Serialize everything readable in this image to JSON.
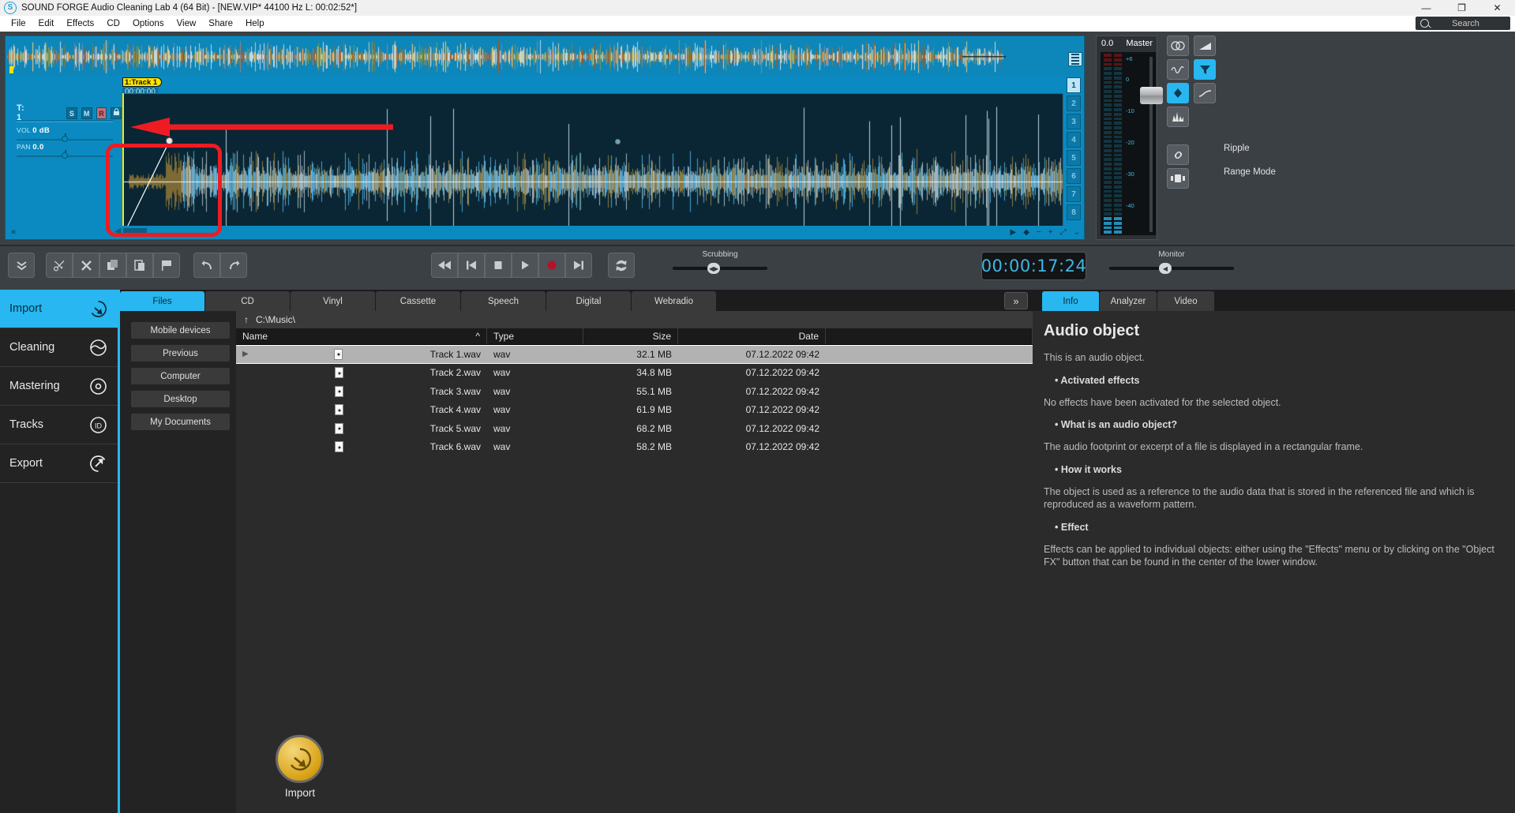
{
  "window": {
    "app_icon": "sound-forge-logo",
    "title": "SOUND FORGE Audio Cleaning Lab 4 (64 Bit) - [NEW.VIP*   44100 Hz L: 00:02:52*]",
    "minimize": "—",
    "restore": "❐",
    "close": "✕"
  },
  "menubar": {
    "items": [
      "File",
      "Edit",
      "Effects",
      "CD",
      "Options",
      "View",
      "Share",
      "Help"
    ]
  },
  "search": {
    "placeholder": "Search",
    "icon": "search-icon"
  },
  "arranger": {
    "track_tab": "1:Track 1",
    "ruler_time": "00:00:00",
    "track_label": "T:  1",
    "buttons": [
      "S",
      "M",
      "R",
      "🔒"
    ],
    "vol_label": "VOL",
    "vol_value": "0 dB",
    "pan_label": "PAN",
    "pan_value": "0.0",
    "track_numbers": [
      "1",
      "2",
      "3",
      "4",
      "5",
      "6",
      "7",
      "8"
    ],
    "active_track": "1",
    "fx_icon": "gear-icon",
    "collapse_icon": "«"
  },
  "master": {
    "value": "0.0",
    "label": "Master",
    "scale": [
      "+6",
      "0",
      "-10",
      "-20",
      "-30",
      "-40"
    ]
  },
  "tools": {
    "col1": [
      "stereo-icon",
      "waveform-icon",
      "object-icon",
      "peaks-icon"
    ],
    "col2": [
      "fade-in-icon",
      "fade-funnel-icon",
      "fade-curve-icon"
    ],
    "ripple_label": "Ripple",
    "ripple_icon": "link-icon",
    "range_label": "Range Mode",
    "range_icon": "range-icon"
  },
  "toolbar": {
    "left_group": [
      "chevron-double-down-icon"
    ],
    "edit_group": [
      "scissors-cut-icon",
      "delete-x-icon",
      "copy-icon",
      "paste-icon",
      "marker-flag-icon"
    ],
    "history_group": [
      "undo-icon",
      "redo-icon"
    ]
  },
  "transport": {
    "buttons": [
      "skip-start-icon",
      "prev-marker-icon",
      "stop-icon",
      "play-icon",
      "record-icon",
      "skip-end-icon"
    ],
    "loop_icon": "loop-icon",
    "scrubbing_label": "Scrubbing",
    "timecode": "00:00:17:24",
    "monitor_label": "Monitor"
  },
  "sidebar": {
    "items": [
      {
        "label": "Import",
        "icon": "import-arrow-icon",
        "active": true
      },
      {
        "label": "Cleaning",
        "icon": "cleaning-icon",
        "active": false
      },
      {
        "label": "Mastering",
        "icon": "mastering-disc-icon",
        "active": false
      },
      {
        "label": "Tracks",
        "icon": "tracks-id-icon",
        "active": false
      },
      {
        "label": "Export",
        "icon": "export-arrow-icon",
        "active": false
      }
    ]
  },
  "source_tabs": {
    "items": [
      "Files",
      "CD",
      "Vinyl",
      "Cassette",
      "Speech",
      "Digital",
      "Webradio"
    ],
    "active": "Files",
    "expand_icon": "chevron-double-right-icon"
  },
  "places": {
    "buttons": [
      "Mobile devices",
      "Previous",
      "Computer",
      "Desktop",
      "My Documents"
    ]
  },
  "import_button": {
    "label": "Import",
    "icon": "import-circle-icon"
  },
  "filebrowser": {
    "path": "C:\\Music\\",
    "up_icon": "arrow-up-icon",
    "columns": [
      "Name",
      "Type",
      "Size",
      "Date"
    ],
    "sort_indicator": "^",
    "rows": [
      {
        "name": "Track 1.wav",
        "type": "wav",
        "size": "32.1 MB",
        "date": "07.12.2022 09:42",
        "selected": true
      },
      {
        "name": "Track 2.wav",
        "type": "wav",
        "size": "34.8 MB",
        "date": "07.12.2022 09:42",
        "selected": false
      },
      {
        "name": "Track 3.wav",
        "type": "wav",
        "size": "55.1 MB",
        "date": "07.12.2022 09:42",
        "selected": false
      },
      {
        "name": "Track 4.wav",
        "type": "wav",
        "size": "61.9 MB",
        "date": "07.12.2022 09:42",
        "selected": false
      },
      {
        "name": "Track 5.wav",
        "type": "wav",
        "size": "68.2 MB",
        "date": "07.12.2022 09:42",
        "selected": false
      },
      {
        "name": "Track 6.wav",
        "type": "wav",
        "size": "58.2 MB",
        "date": "07.12.2022 09:42",
        "selected": false
      }
    ]
  },
  "info_panel": {
    "tabs": [
      "Info",
      "Analyzer",
      "Video"
    ],
    "active_tab": "Info",
    "heading": "Audio object",
    "intro": "This is an audio object.",
    "sections": [
      {
        "bullet": "Activated effects",
        "text": "No effects have been activated for the selected object."
      },
      {
        "bullet": "What is an audio object?",
        "text": "The audio footprint or excerpt of a file is displayed in a rectangular frame."
      },
      {
        "bullet": "How it works",
        "text": "The object is used as a reference to the audio data that is stored in the referenced file and which is reproduced as a waveform pattern."
      },
      {
        "bullet": "Effect",
        "text": "Effects can be applied to individual objects: either using the \"Effects\" menu or by clicking on the \"Object FX\" button that can be found in the center of the lower window."
      }
    ]
  },
  "annotations": {
    "arrow_color": "#ee1c22",
    "box_color": "#ee1c22"
  },
  "colors": {
    "accent": "#28b7f0",
    "arranger_blue": "#0a8ac0",
    "timeline_dark": "#0a2634",
    "panel_bg": "#3b4045",
    "record_red": "#b5122a"
  }
}
